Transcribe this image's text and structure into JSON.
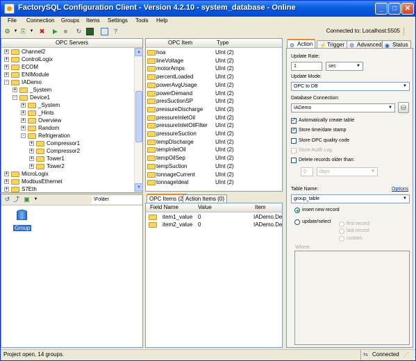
{
  "window": {
    "title": "FactorySQL Configuration Client - Version 4.2.10 - system_database - Online"
  },
  "menu": [
    "File",
    "Connection",
    "Groups",
    "Items",
    "Settings",
    "Tools",
    "Help"
  ],
  "toolbar": {
    "connected": "Connected to: Localhost:5505"
  },
  "opc_servers": {
    "header": "OPC Servers",
    "rows": [
      {
        "label": "Channel2",
        "depth": 0,
        "exp": "+"
      },
      {
        "label": "ControlLogix",
        "depth": 0,
        "exp": "+"
      },
      {
        "label": "ECOM",
        "depth": 0,
        "exp": "+"
      },
      {
        "label": "ENIModule",
        "depth": 0,
        "exp": "+"
      },
      {
        "label": "IADemo",
        "depth": 0,
        "exp": "-"
      },
      {
        "label": "_System",
        "depth": 1,
        "exp": "+"
      },
      {
        "label": "Device1",
        "depth": 1,
        "exp": "-"
      },
      {
        "label": "_System",
        "depth": 2,
        "exp": "+"
      },
      {
        "label": "_Hints",
        "depth": 2,
        "exp": "+"
      },
      {
        "label": "Overview",
        "depth": 2,
        "exp": "+"
      },
      {
        "label": "Random",
        "depth": 2,
        "exp": "+"
      },
      {
        "label": "Refrigeration",
        "depth": 2,
        "exp": "-"
      },
      {
        "label": "Compressor1",
        "depth": 3,
        "exp": "+"
      },
      {
        "label": "Compressor2",
        "depth": 3,
        "exp": "+"
      },
      {
        "label": "Tower1",
        "depth": 3,
        "exp": "+"
      },
      {
        "label": "Tower2",
        "depth": 3,
        "exp": "+"
      },
      {
        "label": "MicroLogix",
        "depth": 0,
        "exp": "+"
      },
      {
        "label": "ModbusEthernet",
        "depth": 0,
        "exp": "+"
      },
      {
        "label": "S7Eth",
        "depth": 0,
        "exp": "+"
      }
    ]
  },
  "groups_panel": {
    "path": "\\Folder",
    "group_label": "Group"
  },
  "opc_items": {
    "col_item": "OPC Item",
    "col_type": "Type",
    "rows": [
      {
        "name": "hoa",
        "type": "UInt (2)"
      },
      {
        "name": "lineVoltage",
        "type": "UInt (2)"
      },
      {
        "name": "motorAmps",
        "type": "UInt (2)"
      },
      {
        "name": "percentLoaded",
        "type": "UInt (2)"
      },
      {
        "name": "powerAvgUsage",
        "type": "UInt (2)"
      },
      {
        "name": "powerDemand",
        "type": "UInt (2)"
      },
      {
        "name": "presSuctionSP",
        "type": "UInt (2)"
      },
      {
        "name": "pressureDischarge",
        "type": "UInt (2)"
      },
      {
        "name": "pressureInletOil",
        "type": "UInt (2)"
      },
      {
        "name": "pressureInletOilFilter",
        "type": "UInt (2)"
      },
      {
        "name": "pressureSuction",
        "type": "UInt (2)"
      },
      {
        "name": "tempDischarge",
        "type": "UInt (2)"
      },
      {
        "name": "tempInletOil",
        "type": "UInt (2)"
      },
      {
        "name": "tempOilSep",
        "type": "UInt (2)"
      },
      {
        "name": "tempSuction",
        "type": "UInt (2)"
      },
      {
        "name": "tonnageCurrent",
        "type": "UInt (2)"
      },
      {
        "name": "tonnageIdeal",
        "type": "UInt (2)"
      }
    ]
  },
  "items_tabs": [
    "OPC Items (2)",
    "Action Items (0)"
  ],
  "items_table": {
    "cols": [
      "Field Name",
      "Value",
      "Item"
    ],
    "rows": [
      {
        "field": "item1_value",
        "value": "0",
        "item": "IADemo.De"
      },
      {
        "field": "item2_value",
        "value": "0",
        "item": "IADemo.De"
      }
    ]
  },
  "right_tabs": [
    "Action",
    "Trigger",
    "Advanced",
    "Status"
  ],
  "action": {
    "update_rate_label": "Update Rate:",
    "update_rate_value": "1",
    "update_rate_unit": "sec",
    "update_mode_label": "Update Mode:",
    "update_mode_value": "OPC to DB",
    "db_conn_label": "Database Connection:",
    "db_conn_value": "IADemo",
    "cb_auto_create": "Automatically create table",
    "cb_store_time": "Store time/date stamp",
    "cb_store_quality": "Store OPC quality code",
    "cb_audit": "Store Audit Log",
    "cb_delete_old": "Delete records older than:",
    "delete_num": "0",
    "delete_unit": "days",
    "table_name_label": "Table Name:",
    "options_link": "Options",
    "table_name_value": "group_table",
    "rb_insert": "insert new record",
    "rb_update": "update/select",
    "rb_first": "first record",
    "rb_last": "last record",
    "rb_custom": "custom",
    "where_label": "Where:"
  },
  "status": {
    "left": "Project open, 14 groups.",
    "right": "Connected"
  }
}
